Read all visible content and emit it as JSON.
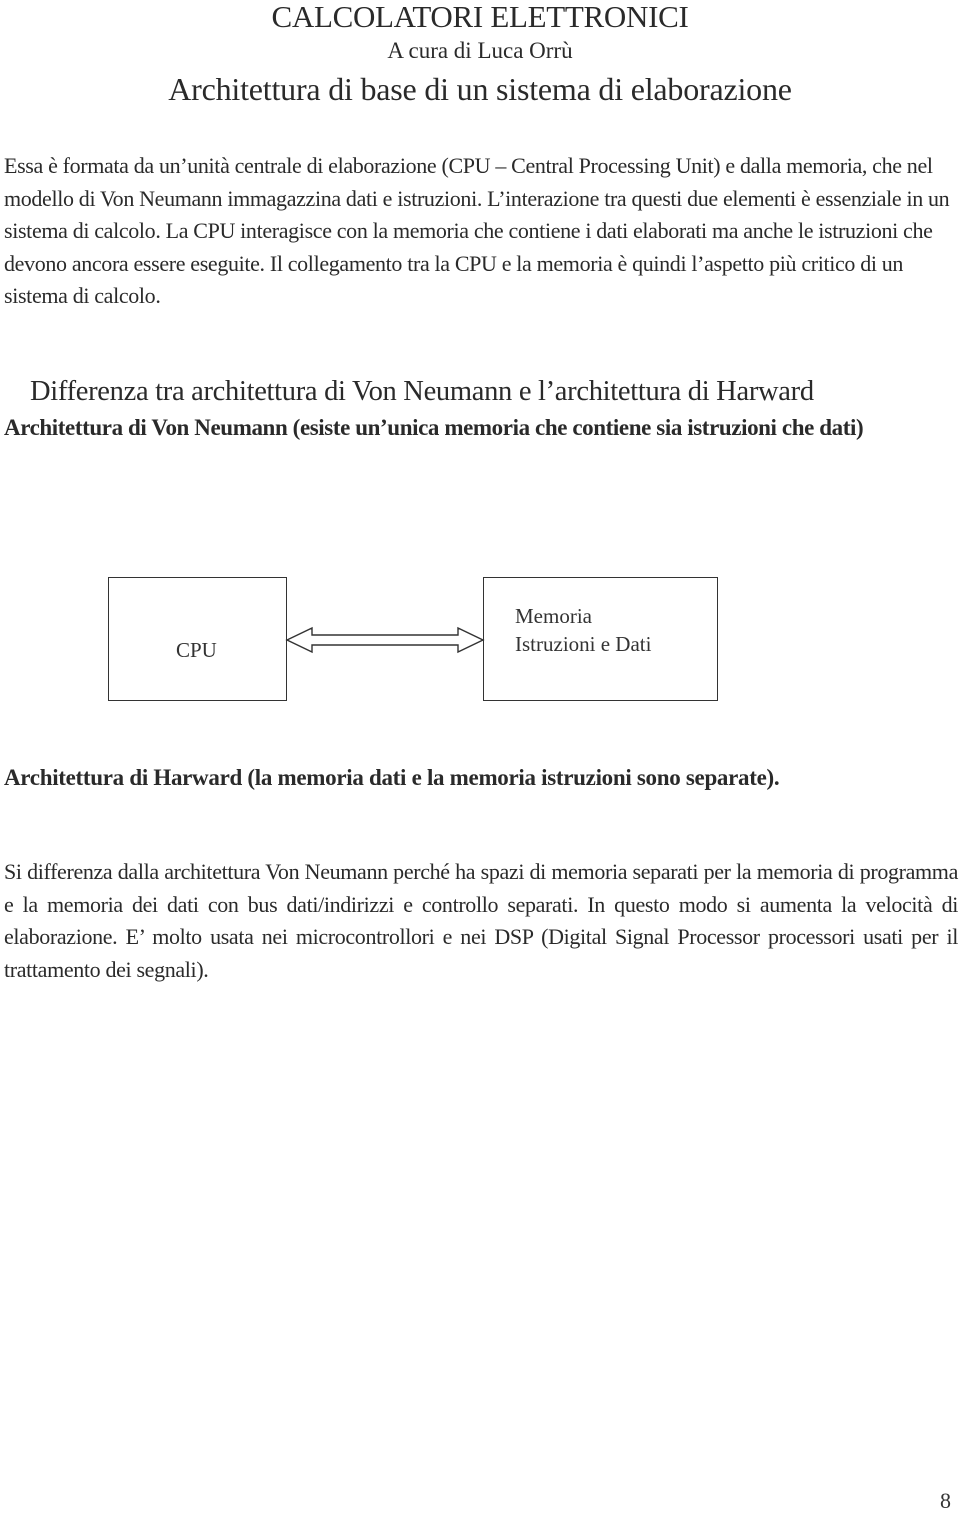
{
  "header": {
    "title": "CALCOLATORI ELETTRONICI",
    "author": "A cura di Luca Orrù",
    "heading": "Architettura di base di un sistema di elaborazione"
  },
  "intro": {
    "text": "Essa è formata da un’unità centrale di elaborazione (CPU – Central Processing Unit) e dalla memoria, che nel modello di Von Neumann immagazzina dati e istruzioni. L’interazione tra questi due elementi è essenziale in un sistema di calcolo. La CPU interagisce con la memoria che contiene i dati elaborati ma anche le istruzioni che devono ancora essere eseguite. Il collegamento tra la CPU e la memoria è quindi l’aspetto più critico di un sistema di calcolo."
  },
  "comparison": {
    "title": "Differenza tra architettura di Von Neumann e l’architettura di Harward"
  },
  "von_neumann": {
    "heading": "Architettura di Von Neumann (esiste un’unica memoria che contiene sia istruzioni che dati)",
    "diagram": {
      "cpu_label": "CPU",
      "memory_label_line1": "Memoria",
      "memory_label_line2": "Istruzioni e Dati",
      "connector_icon": "double-headed-arrow"
    }
  },
  "harvard": {
    "heading": "Architettura di Harward (la memoria dati e la memoria istruzioni sono separate).",
    "body": "Si differenza dalla architettura Von Neumann perché ha spazi di memoria separati per la memoria di programma e la memoria dei dati con bus dati/indirizzi e controllo separati. In questo modo si aumenta la velocità di elaborazione. E’ molto usata nei microcontrollori e nei DSP (Digital Signal Processor processori usati per il trattamento dei segnali)."
  },
  "footer": {
    "page_number": "8"
  }
}
